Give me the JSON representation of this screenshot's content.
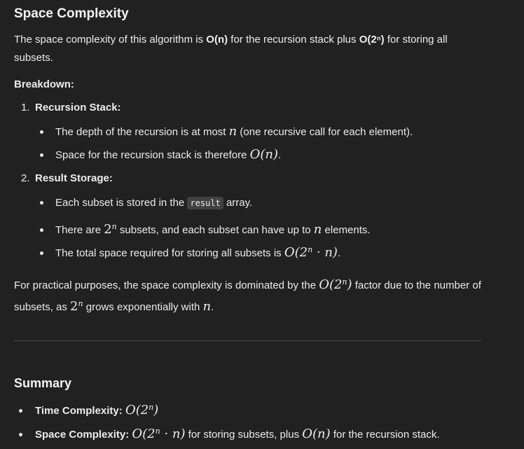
{
  "space": {
    "title": "Space Complexity",
    "intro_a": "The space complexity of this algorithm is ",
    "intro_b": "O(n)",
    "intro_c": " for the recursion stack plus ",
    "intro_d": "O(2ⁿ)",
    "intro_e": " for storing all subsets.",
    "breakdown": "Breakdown:",
    "items": [
      {
        "num": "1.",
        "label": "Recursion Stack:",
        "bullets": [
          {
            "a": "The depth of the recursion is at most ",
            "m": "n",
            "b": " (one recursive call for each element)."
          },
          {
            "a": "Space for the recursion stack is therefore ",
            "m": "O(n)",
            "b": "."
          }
        ]
      },
      {
        "num": "2.",
        "label": "Result Storage:",
        "bullets": [
          {
            "a": "Each subset is stored in the ",
            "code": "result",
            "b": " array."
          },
          {
            "a": "There are ",
            "m": "2",
            "sup": "n",
            "b": " subsets, and each subset can have up to ",
            "m2": "n",
            "c": " elements."
          },
          {
            "a": "The total space required for storing all subsets is ",
            "m": "O(2",
            "sup": "n",
            "m3": " · n)",
            "b": "."
          }
        ]
      }
    ],
    "practical_a": "For practical purposes, the space complexity is dominated by the ",
    "practical_m": "O(2",
    "practical_sup": "n",
    "practical_m2": ")",
    "practical_b": " factor due to the number of subsets, as ",
    "practical_m3": "2",
    "practical_sup2": "n",
    "practical_c": " grows exponentially with ",
    "practical_m4": "n",
    "practical_d": "."
  },
  "summary": {
    "title": "Summary",
    "time_label": "Time Complexity:",
    "time_m": "O(2",
    "time_sup": "n",
    "time_m2": ")",
    "space_label": "Space Complexity:",
    "space_m": "O(2",
    "space_sup": "n",
    "space_m2": " · n)",
    "space_a": " for storing subsets, plus ",
    "space_m3": "O(n)",
    "space_b": " for the recursion stack."
  }
}
